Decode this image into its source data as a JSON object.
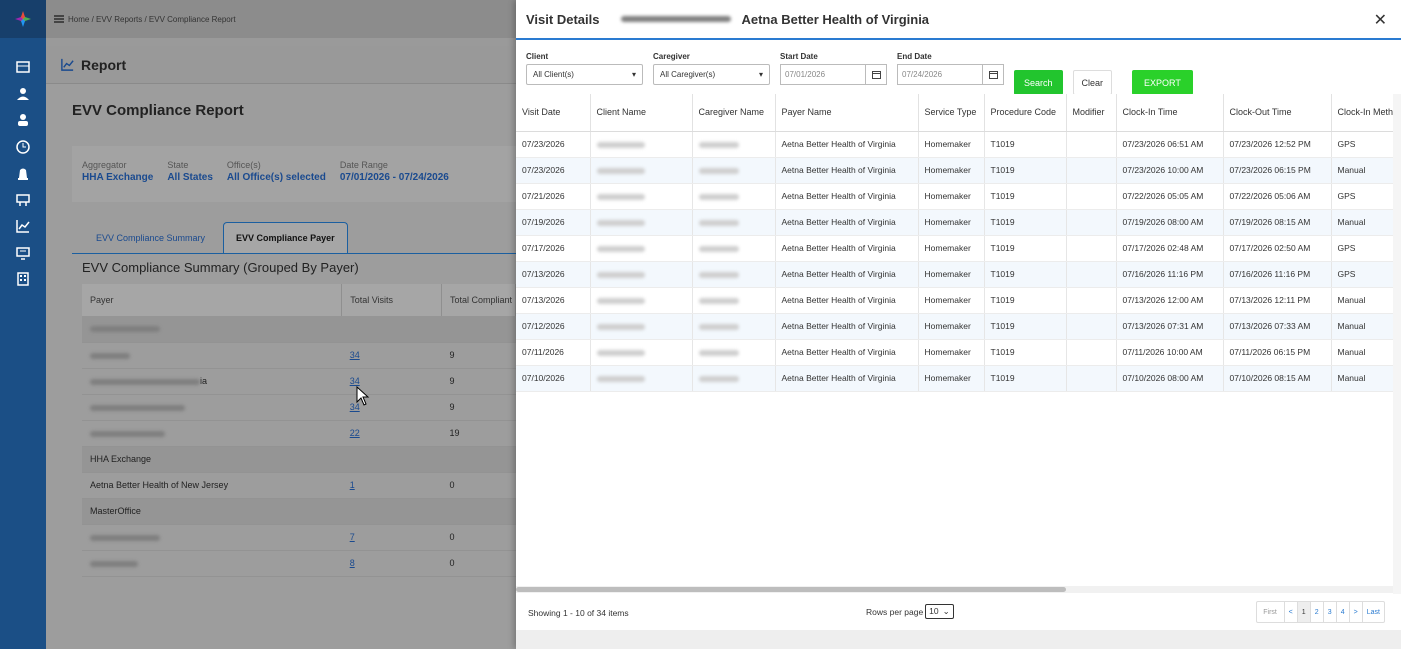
{
  "rail": {
    "icons": [
      "dashboard-icon",
      "user-icon",
      "person-icon",
      "clock-icon",
      "alert-icon",
      "schedule-icon",
      "chart-icon",
      "monitor-icon",
      "building-icon"
    ]
  },
  "breadcrumb": "Home / EVV Reports / EVV Compliance Report",
  "report": {
    "header": "Report",
    "title": "EVV Compliance Report",
    "filters": [
      {
        "label": "Aggregator",
        "value": "HHA Exchange"
      },
      {
        "label": "State",
        "value": "All States"
      },
      {
        "label": "Office(s)",
        "value": "All Office(s) selected"
      },
      {
        "label": "Date Range",
        "value": "07/01/2026 - 07/24/2026"
      }
    ],
    "tabs": [
      "EVV Compliance Summary",
      "EVV Compliance Payer"
    ],
    "group_title": "EVV Compliance Summary (Grouped By Payer)",
    "columns": [
      "Payer",
      "Total Visits",
      "Total Compliant"
    ],
    "rows": [
      {
        "group": true,
        "payer": "",
        "visits": "",
        "compliant": ""
      },
      {
        "group": false,
        "payer": "",
        "visits": "34",
        "compliant": "9"
      },
      {
        "group": false,
        "payer": "ia",
        "visits": "34",
        "compliant": "9"
      },
      {
        "group": false,
        "payer": "",
        "visits": "34",
        "compliant": "9"
      },
      {
        "group": false,
        "payer": "",
        "visits": "22",
        "compliant": "19"
      },
      {
        "group": true,
        "payer": "HHA Exchange",
        "visits": "",
        "compliant": ""
      },
      {
        "group": false,
        "payer": "Aetna Better Health of New Jersey",
        "visits": "1",
        "compliant": "0"
      },
      {
        "group": true,
        "payer": "MasterOffice",
        "visits": "",
        "compliant": ""
      },
      {
        "group": false,
        "payer": "",
        "visits": "7",
        "compliant": "0"
      },
      {
        "group": false,
        "payer": "",
        "visits": "8",
        "compliant": "0"
      }
    ]
  },
  "modal": {
    "title_prefix": "Visit Details",
    "title_payer": "Aetna Better Health of Virginia",
    "close": "✕",
    "client_label": "Client",
    "client_value": "All Client(s)",
    "caregiver_label": "Caregiver",
    "caregiver_value": "All Caregiver(s)",
    "start_label": "Start Date",
    "start_value": "07/01/2026",
    "end_label": "End Date",
    "end_value": "07/24/2026",
    "search": "Search",
    "clear": "Clear",
    "export": "EXPORT",
    "columns": [
      "Visit Date",
      "Client Name",
      "Caregiver Name",
      "Payer Name",
      "Service Type",
      "Procedure Code",
      "Modifier",
      "Clock-In Time",
      "Clock-Out Time",
      "Clock-In Method"
    ],
    "rows": [
      {
        "visit_date": "07/23/2026",
        "payer": "Aetna Better Health of Virginia",
        "service": "Homemaker",
        "code": "T1019",
        "modifier": "",
        "in": "07/23/2026 06:51 AM",
        "out": "07/23/2026 12:52 PM",
        "method": "GPS"
      },
      {
        "visit_date": "07/23/2026",
        "payer": "Aetna Better Health of Virginia",
        "service": "Homemaker",
        "code": "T1019",
        "modifier": "",
        "in": "07/23/2026 10:00 AM",
        "out": "07/23/2026 06:15 PM",
        "method": "Manual"
      },
      {
        "visit_date": "07/21/2026",
        "payer": "Aetna Better Health of Virginia",
        "service": "Homemaker",
        "code": "T1019",
        "modifier": "",
        "in": "07/22/2026 05:05 AM",
        "out": "07/22/2026 05:06 AM",
        "method": "GPS"
      },
      {
        "visit_date": "07/19/2026",
        "payer": "Aetna Better Health of Virginia",
        "service": "Homemaker",
        "code": "T1019",
        "modifier": "",
        "in": "07/19/2026 08:00 AM",
        "out": "07/19/2026 08:15 AM",
        "method": "Manual"
      },
      {
        "visit_date": "07/17/2026",
        "payer": "Aetna Better Health of Virginia",
        "service": "Homemaker",
        "code": "T1019",
        "modifier": "",
        "in": "07/17/2026 02:48 AM",
        "out": "07/17/2026 02:50 AM",
        "method": "GPS"
      },
      {
        "visit_date": "07/13/2026",
        "payer": "Aetna Better Health of Virginia",
        "service": "Homemaker",
        "code": "T1019",
        "modifier": "",
        "in": "07/16/2026 11:16 PM",
        "out": "07/16/2026 11:16 PM",
        "method": "GPS"
      },
      {
        "visit_date": "07/13/2026",
        "payer": "Aetna Better Health of Virginia",
        "service": "Homemaker",
        "code": "T1019",
        "modifier": "",
        "in": "07/13/2026 12:00 AM",
        "out": "07/13/2026 12:11 PM",
        "method": "Manual"
      },
      {
        "visit_date": "07/12/2026",
        "payer": "Aetna Better Health of Virginia",
        "service": "Homemaker",
        "code": "T1019",
        "modifier": "",
        "in": "07/13/2026 07:31 AM",
        "out": "07/13/2026 07:33 AM",
        "method": "Manual"
      },
      {
        "visit_date": "07/11/2026",
        "payer": "Aetna Better Health of Virginia",
        "service": "Homemaker",
        "code": "T1019",
        "modifier": "",
        "in": "07/11/2026 10:00 AM",
        "out": "07/11/2026 06:15 PM",
        "method": "Manual"
      },
      {
        "visit_date": "07/10/2026",
        "payer": "Aetna Better Health of Virginia",
        "service": "Homemaker",
        "code": "T1019",
        "modifier": "",
        "in": "07/10/2026 08:00 AM",
        "out": "07/10/2026 08:15 AM",
        "method": "Manual"
      }
    ],
    "showing": "Showing 1 - 10 of 34 items",
    "rows_per_page_label": "Rows per page",
    "rows_per_page_value": "10",
    "pager": [
      "First",
      "<",
      "1",
      "2",
      "3",
      "4",
      ">",
      "Last"
    ]
  },
  "colors": {
    "rail": "#1b4f86",
    "accent": "#2a7bd1",
    "green": "#22c52e",
    "link": "#1a4a8f"
  }
}
